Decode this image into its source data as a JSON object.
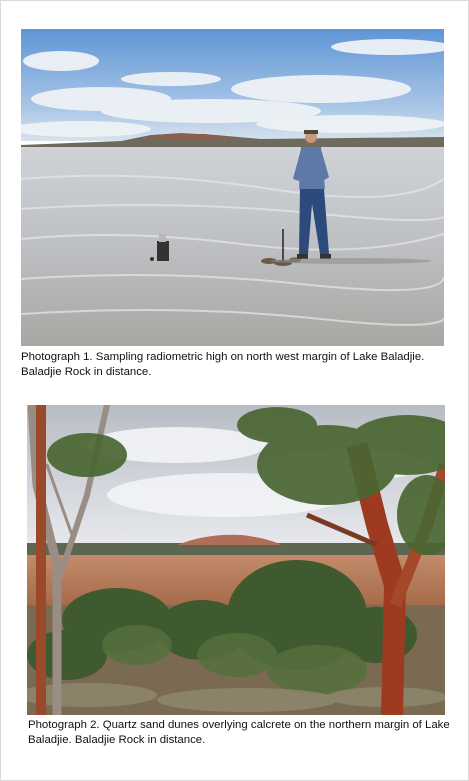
{
  "photographs": [
    {
      "caption": "Photograph 1. Sampling radiometric high on north west margin of Lake Baladjie. Baladjie Rock in distance."
    },
    {
      "caption": "Photograph 2. Quartz sand dunes overlying calcrete on the northern margin of Lake Baladjie. Baladjie Rock in distance."
    }
  ]
}
